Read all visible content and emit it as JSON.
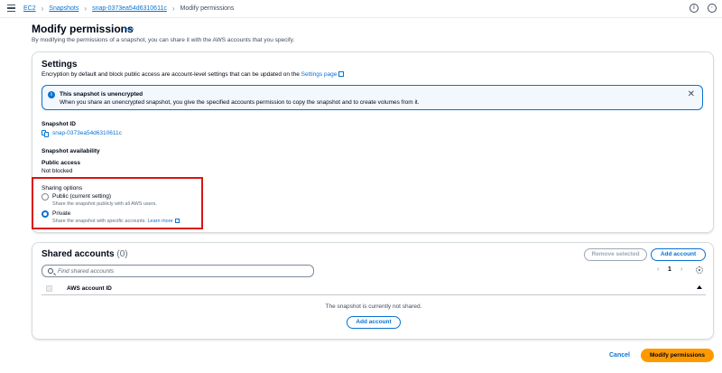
{
  "breadcrumb": {
    "items": [
      "EC2",
      "Snapshots",
      "snap-0373ea54d6310611c"
    ],
    "current": "Modify permissions"
  },
  "header": {
    "title": "Modify permissions",
    "info": "Info",
    "description": "By modifying the permissions of a snapshot, you can share it with the AWS accounts that you specify."
  },
  "settings": {
    "title": "Settings",
    "description": "Encryption by default and block public access are account-level settings that can be updated on the",
    "settings_link": "Settings page",
    "alert": {
      "title": "This snapshot is unencrypted",
      "text": "When you share an unencrypted snapshot, you give the specified accounts permission to copy the snapshot and to create volumes from it."
    },
    "snapshot_id_label": "Snapshot ID",
    "snapshot_id": "snap-0373ea54d6310611c",
    "availability_label": "Snapshot availability",
    "public_access_label": "Public access",
    "public_access_value": "Not blocked",
    "sharing": {
      "label": "Sharing options",
      "options": [
        {
          "label": "Public (current setting)",
          "desc": "Share the snapshot publicly with all AWS users.",
          "checked": false
        },
        {
          "label": "Private",
          "desc": "Share the snapshot with specific accounts.",
          "link": "Learn more",
          "checked": true
        }
      ]
    }
  },
  "shared_accounts": {
    "title": "Shared accounts",
    "count": "(0)",
    "remove_button": "Remove selected",
    "add_button": "Add account",
    "search_placeholder": "Find shared accounts",
    "page_number": "1",
    "column": "AWS account ID",
    "empty_message": "The snapshot is currently not shared.",
    "empty_add_button": "Add account"
  },
  "footer": {
    "cancel": "Cancel",
    "submit": "Modify permissions"
  },
  "colors": {
    "link": "#0972d3",
    "primary": "#ff9900",
    "highlight": "#d91515"
  }
}
